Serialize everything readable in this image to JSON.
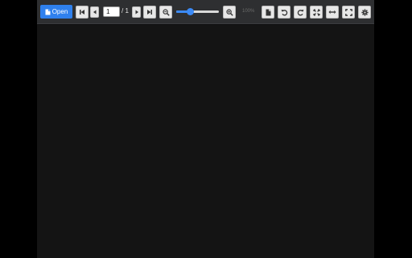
{
  "toolbar": {
    "open_label": "Open",
    "current_page": "1",
    "page_total": "/ 1",
    "zoom_label": "100%",
    "zoom_slider_level_percent": 30,
    "icons": [
      "file-icon",
      "first-page-icon",
      "previous-page-icon",
      "next-page-icon",
      "last-page-icon",
      "zoom-out-icon",
      "zoom-in-icon",
      "page-fit-icon",
      "rotate-left-icon",
      "rotate-right-icon",
      "fit-page-icon",
      "fit-width-icon",
      "fullscreen-icon",
      "settings-icon"
    ]
  },
  "colors": {
    "accent": "#2f80ed",
    "toolbar_bg": "#2e2f31",
    "viewer_bg": "#141414",
    "page_bg": "#000000"
  }
}
